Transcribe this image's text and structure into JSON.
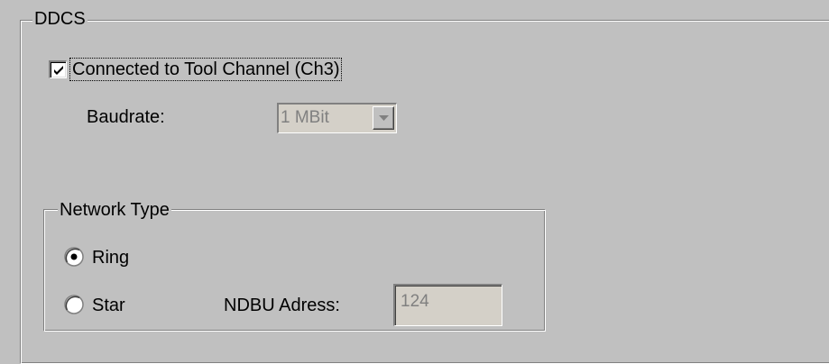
{
  "ddcs": {
    "title": "DDCS",
    "connected_checkbox": {
      "label": "Connected to Tool Channel (Ch3)",
      "checked": true
    },
    "baudrate": {
      "label": "Baudrate:",
      "value": "1 MBit",
      "enabled": false
    },
    "network_type": {
      "title": "Network Type",
      "options": [
        {
          "label": "Ring",
          "selected": true
        },
        {
          "label": "Star",
          "selected": false
        }
      ],
      "ndbu_address": {
        "label": "NDBU Adress:",
        "value": "124",
        "enabled": false
      }
    }
  }
}
